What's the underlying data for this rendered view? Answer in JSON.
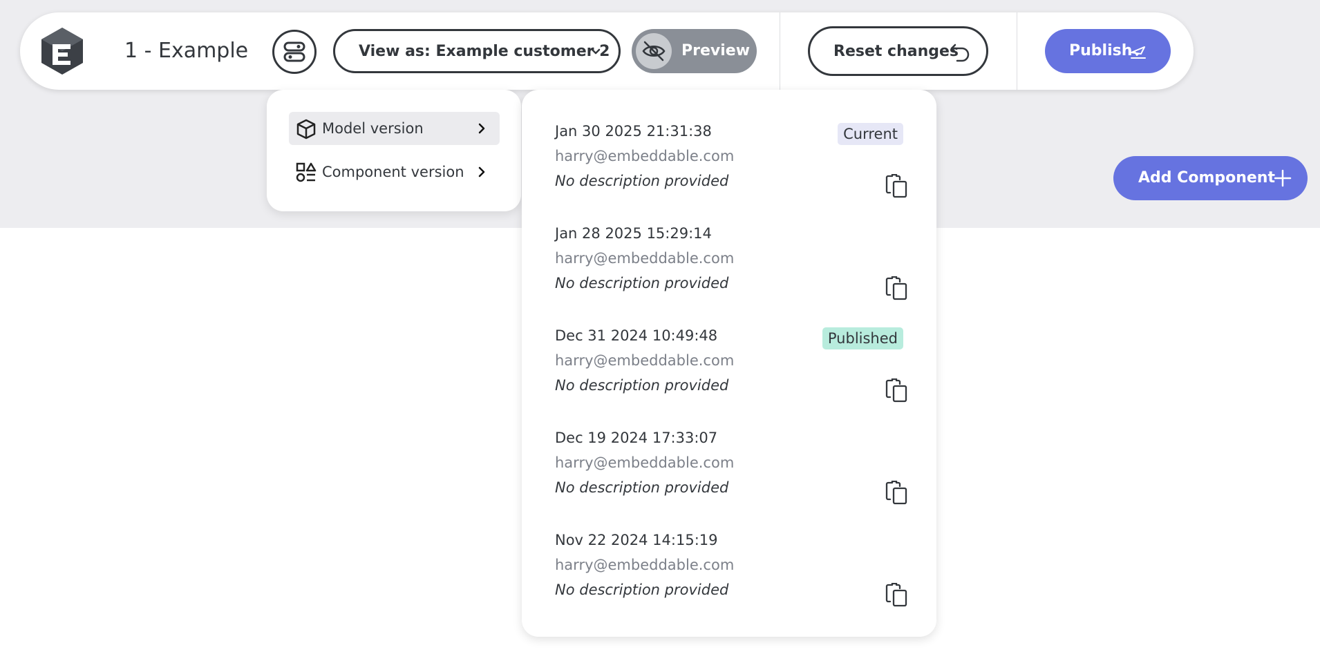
{
  "toolbar": {
    "title": "1 - Example",
    "view_as_label": "View as: Example customer 2",
    "preview_label": "Preview",
    "reset_label": "Reset changes",
    "publish_label": "Publish"
  },
  "add_component_label": "Add Component",
  "version_menu": {
    "items": [
      {
        "label": "Model version",
        "icon": "cube-icon",
        "active": true
      },
      {
        "label": "Component version",
        "icon": "components-icon",
        "active": false
      }
    ]
  },
  "versions": [
    {
      "date": "Jan 30 2025 21:31:38",
      "user": "harry@embeddable.com",
      "description": "No description provided",
      "badge": "Current"
    },
    {
      "date": "Jan 28 2025 15:29:14",
      "user": "harry@embeddable.com",
      "description": "No description provided",
      "badge": ""
    },
    {
      "date": "Dec 31 2024 10:49:48",
      "user": "harry@embeddable.com",
      "description": "No description provided",
      "badge": "Published"
    },
    {
      "date": "Dec 19 2024 17:33:07",
      "user": "harry@embeddable.com",
      "description": "No description provided",
      "badge": ""
    },
    {
      "date": "Nov 22 2024 14:15:19",
      "user": "harry@embeddable.com",
      "description": "No description provided",
      "badge": ""
    }
  ],
  "colors": {
    "accent": "#6673e0",
    "text": "#33373c",
    "muted": "#7c8089",
    "current_badge": "#e6e7f6",
    "published_badge": "#b8ecdd"
  }
}
